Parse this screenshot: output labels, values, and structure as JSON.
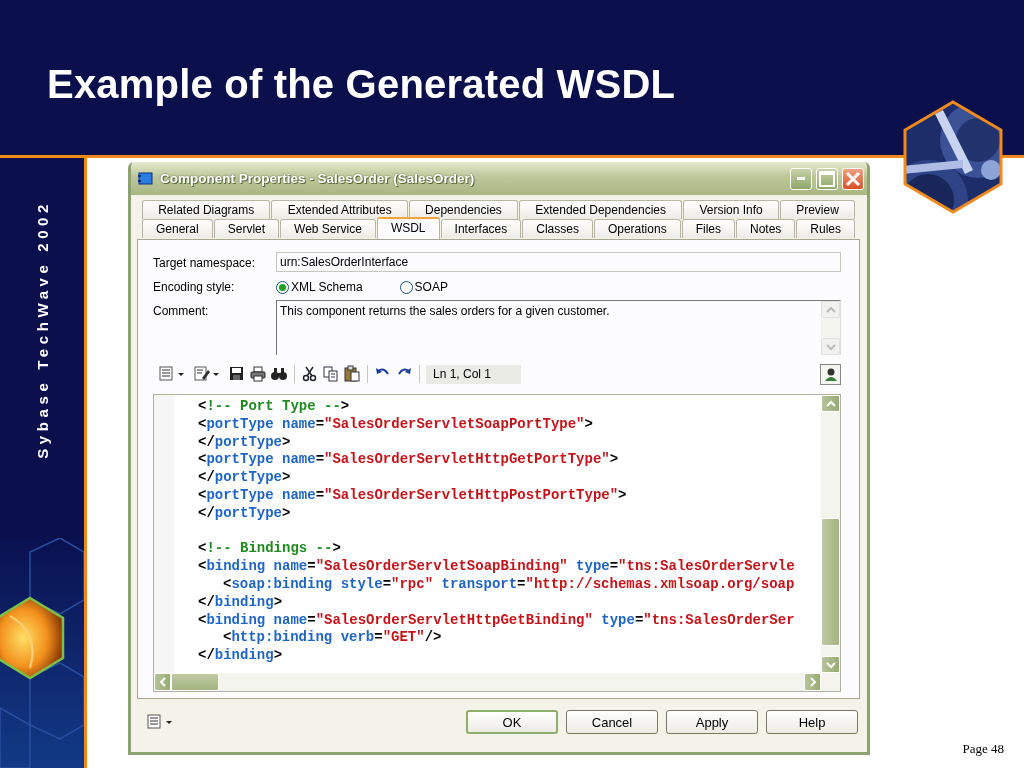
{
  "slide": {
    "title": "Example of the Generated WSDL",
    "side_text": "Sybase TechWave 2002",
    "page": "Page 48"
  },
  "window": {
    "title": "Component Properties - SalesOrder (SalesOrder)"
  },
  "tabs": [
    [
      {
        "label": "Related Diagrams",
        "selected": false
      },
      {
        "label": "Extended Attributes",
        "selected": false
      },
      {
        "label": "Dependencies",
        "selected": false
      },
      {
        "label": "Extended Dependencies",
        "selected": false
      },
      {
        "label": "Version Info",
        "selected": false
      },
      {
        "label": "Preview",
        "selected": false
      }
    ],
    [
      {
        "label": "General",
        "selected": false
      },
      {
        "label": "Servlet",
        "selected": false
      },
      {
        "label": "Web Service",
        "selected": false
      },
      {
        "label": "WSDL",
        "selected": true
      },
      {
        "label": "Interfaces",
        "selected": false
      },
      {
        "label": "Classes",
        "selected": false
      },
      {
        "label": "Operations",
        "selected": false
      },
      {
        "label": "Files",
        "selected": false
      },
      {
        "label": "Notes",
        "selected": false
      },
      {
        "label": "Rules",
        "selected": false
      }
    ]
  ],
  "form": {
    "target_namespace": {
      "label": "Target namespace:",
      "value": "urn:SalesOrderInterface"
    },
    "encoding_style": {
      "label": "Encoding style:",
      "options": [
        {
          "label": "XML Schema",
          "selected": true
        },
        {
          "label": "SOAP",
          "selected": false
        }
      ]
    },
    "comment": {
      "label": "Comment:",
      "value": "This component returns the sales orders for a given customer."
    }
  },
  "toolbar": {
    "position": "Ln 1, Col 1"
  },
  "code_lines": [
    {
      "kind": "top",
      "tokens": [
        {
          "kind": "bracket",
          "text": "<"
        },
        {
          "kind": "comment",
          "text": "!-- Port Type --"
        },
        {
          "kind": "bracket",
          "text": ">"
        }
      ]
    },
    {
      "kind": "top",
      "tokens": [
        {
          "kind": "bracket",
          "text": "<"
        },
        {
          "kind": "tag",
          "text": "portType"
        },
        {
          "kind": "attr",
          "text": " name"
        },
        {
          "kind": "bracket",
          "text": "="
        },
        {
          "kind": "value",
          "text": "\"SalesOrderServletSoapPortType\""
        },
        {
          "kind": "bracket",
          "text": ">"
        }
      ]
    },
    {
      "kind": "top",
      "tokens": [
        {
          "kind": "bracket",
          "text": "</"
        },
        {
          "kind": "tag",
          "text": "portType"
        },
        {
          "kind": "bracket",
          "text": ">"
        }
      ]
    },
    {
      "kind": "top",
      "tokens": [
        {
          "kind": "bracket",
          "text": "<"
        },
        {
          "kind": "tag",
          "text": "portType"
        },
        {
          "kind": "attr",
          "text": " name"
        },
        {
          "kind": "bracket",
          "text": "="
        },
        {
          "kind": "value",
          "text": "\"SalesOrderServletHttpGetPortType\""
        },
        {
          "kind": "bracket",
          "text": ">"
        }
      ]
    },
    {
      "kind": "top",
      "tokens": [
        {
          "kind": "bracket",
          "text": "</"
        },
        {
          "kind": "tag",
          "text": "portType"
        },
        {
          "kind": "bracket",
          "text": ">"
        }
      ]
    },
    {
      "kind": "top",
      "tokens": [
        {
          "kind": "bracket",
          "text": "<"
        },
        {
          "kind": "tag",
          "text": "portType"
        },
        {
          "kind": "attr",
          "text": " name"
        },
        {
          "kind": "bracket",
          "text": "="
        },
        {
          "kind": "value",
          "text": "\"SalesOrderServletHttpPostPortType\""
        },
        {
          "kind": "bracket",
          "text": ">"
        }
      ]
    },
    {
      "kind": "top",
      "tokens": [
        {
          "kind": "bracket",
          "text": "</"
        },
        {
          "kind": "tag",
          "text": "portType"
        },
        {
          "kind": "bracket",
          "text": ">"
        }
      ]
    },
    {
      "kind": "blank"
    },
    {
      "kind": "top",
      "tokens": [
        {
          "kind": "bracket",
          "text": "<"
        },
        {
          "kind": "comment",
          "text": "!-- Bindings --"
        },
        {
          "kind": "bracket",
          "text": ">"
        }
      ]
    },
    {
      "kind": "top",
      "tokens": [
        {
          "kind": "bracket",
          "text": "<"
        },
        {
          "kind": "tag",
          "text": "binding"
        },
        {
          "kind": "attr",
          "text": " name"
        },
        {
          "kind": "bracket",
          "text": "="
        },
        {
          "kind": "value",
          "text": "\"SalesOrderServletSoapBinding\""
        },
        {
          "kind": "attr",
          "text": " type"
        },
        {
          "kind": "bracket",
          "text": "="
        },
        {
          "kind": "value",
          "text": "\"tns:SalesOrderServle"
        }
      ]
    },
    {
      "kind": "nested",
      "tokens": [
        {
          "kind": "bracket",
          "text": "<"
        },
        {
          "kind": "tag",
          "text": "soap:binding"
        },
        {
          "kind": "attr",
          "text": " style"
        },
        {
          "kind": "bracket",
          "text": "="
        },
        {
          "kind": "value",
          "text": "\"rpc\""
        },
        {
          "kind": "attr",
          "text": " transport"
        },
        {
          "kind": "bracket",
          "text": "="
        },
        {
          "kind": "value",
          "text": "\"http://schemas.xmlsoap.org/soap"
        }
      ]
    },
    {
      "kind": "top",
      "tokens": [
        {
          "kind": "bracket",
          "text": "</"
        },
        {
          "kind": "tag",
          "text": "binding"
        },
        {
          "kind": "bracket",
          "text": ">"
        }
      ]
    },
    {
      "kind": "top",
      "tokens": [
        {
          "kind": "bracket",
          "text": "<"
        },
        {
          "kind": "tag",
          "text": "binding"
        },
        {
          "kind": "attr",
          "text": " name"
        },
        {
          "kind": "bracket",
          "text": "="
        },
        {
          "kind": "value",
          "text": "\"SalesOrderServletHttpGetBinding\""
        },
        {
          "kind": "attr",
          "text": " type"
        },
        {
          "kind": "bracket",
          "text": "="
        },
        {
          "kind": "value",
          "text": "\"tns:SalesOrderSer"
        }
      ]
    },
    {
      "kind": "nested",
      "tokens": [
        {
          "kind": "bracket",
          "text": "<"
        },
        {
          "kind": "tag",
          "text": "http:binding"
        },
        {
          "kind": "attr",
          "text": " verb"
        },
        {
          "kind": "bracket",
          "text": "="
        },
        {
          "kind": "value",
          "text": "\"GET\""
        },
        {
          "kind": "bracket",
          "text": "/>"
        }
      ]
    },
    {
      "kind": "top",
      "tokens": [
        {
          "kind": "bracket",
          "text": "</"
        },
        {
          "kind": "tag",
          "text": "binding"
        },
        {
          "kind": "bracket",
          "text": ">"
        }
      ]
    }
  ],
  "buttons": [
    {
      "label": "OK",
      "kind": "default"
    },
    {
      "label": "Cancel",
      "kind": "normal"
    },
    {
      "label": "Apply",
      "kind": "normal"
    },
    {
      "label": "Help",
      "kind": "normal"
    }
  ]
}
